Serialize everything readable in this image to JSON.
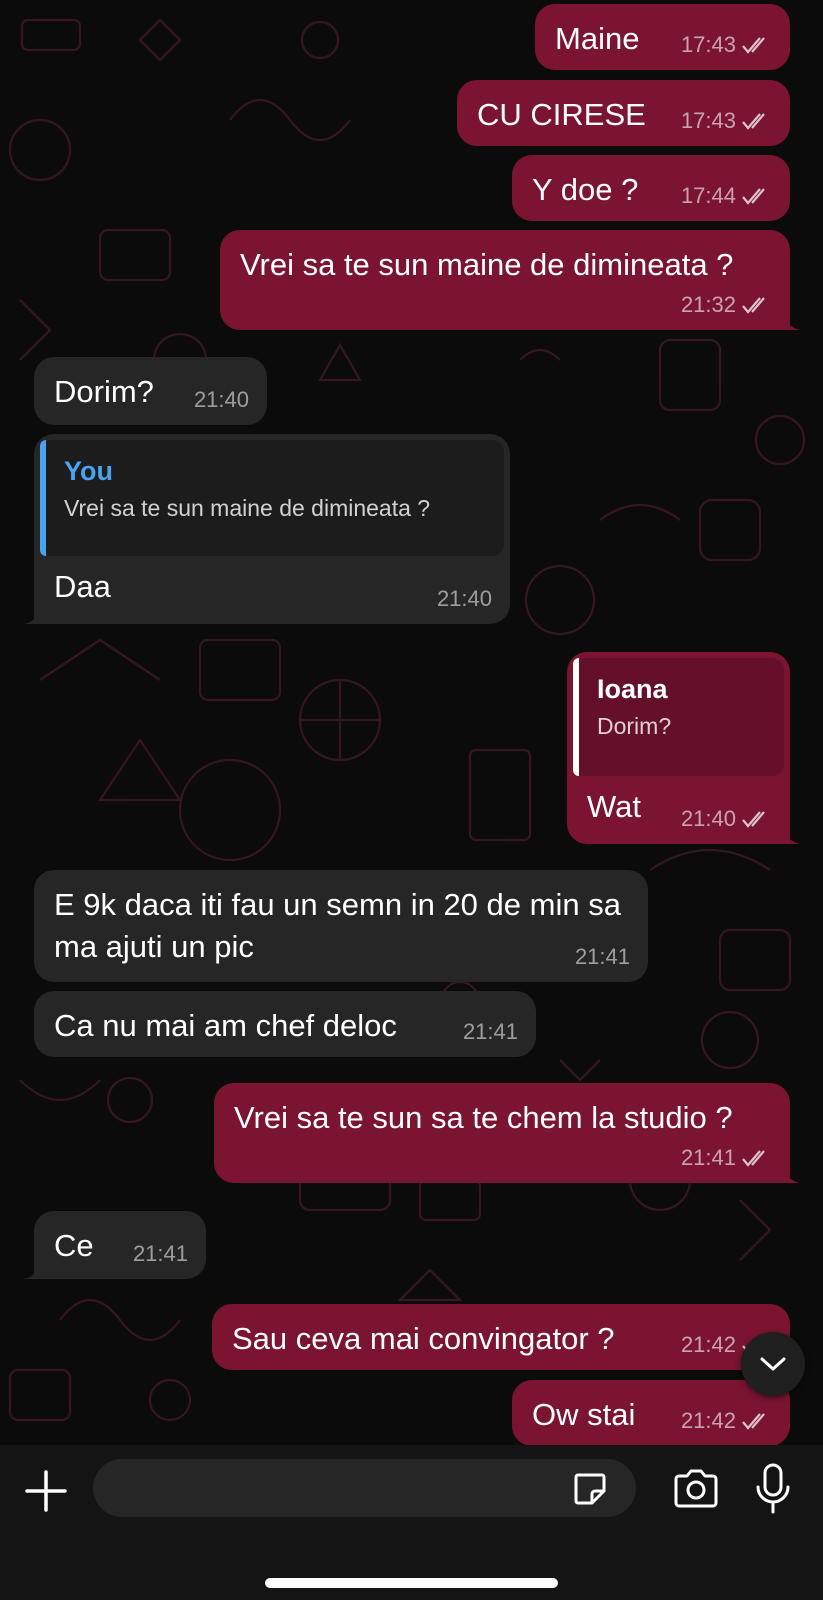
{
  "theme": {
    "outgoing_bubble": "#7a1430",
    "incoming_bubble": "#262626",
    "quote_sender_color": "#4aa3f0",
    "background": "#0b0b0b"
  },
  "messages": [
    {
      "direction": "out",
      "text": "Maine",
      "time": "17:43",
      "status": "read"
    },
    {
      "direction": "out",
      "text": "CU CIRESE",
      "time": "17:43",
      "status": "read"
    },
    {
      "direction": "out",
      "text": "Y doe ?",
      "time": "17:44",
      "status": "read"
    },
    {
      "direction": "out",
      "text": "Vrei sa te sun maine de dimineata ?",
      "time": "21:32",
      "status": "read"
    },
    {
      "direction": "in",
      "text": "Dorim?",
      "time": "21:40"
    },
    {
      "direction": "in",
      "text": "Daa",
      "time": "21:40",
      "reply_to": {
        "sender": "You",
        "text": "Vrei sa te sun maine de dimineata ?"
      }
    },
    {
      "direction": "out",
      "text": "Wat",
      "time": "21:40",
      "status": "read",
      "reply_to": {
        "sender": "Ioana",
        "text": "Dorim?"
      }
    },
    {
      "direction": "in",
      "text": "E 9k daca iti fau un semn in 20 de min sa ma ajuti un pic",
      "time": "21:41"
    },
    {
      "direction": "in",
      "text": "Ca nu mai am chef deloc",
      "time": "21:41"
    },
    {
      "direction": "out",
      "text": "Vrei sa te sun sa te chem la studio ?",
      "time": "21:41",
      "status": "read"
    },
    {
      "direction": "in",
      "text": "Ce",
      "time": "21:41"
    },
    {
      "direction": "out",
      "text": "Sau ceva mai convingator ?",
      "time": "21:42",
      "status": "read"
    },
    {
      "direction": "out",
      "text": "Ow stai",
      "time": "21:42",
      "status": "read"
    }
  ],
  "composer": {
    "placeholder": "",
    "icons": [
      "plus-icon",
      "sticker-icon",
      "camera-icon",
      "microphone-icon"
    ]
  },
  "scroll_button_icon": "chevron-down-icon"
}
